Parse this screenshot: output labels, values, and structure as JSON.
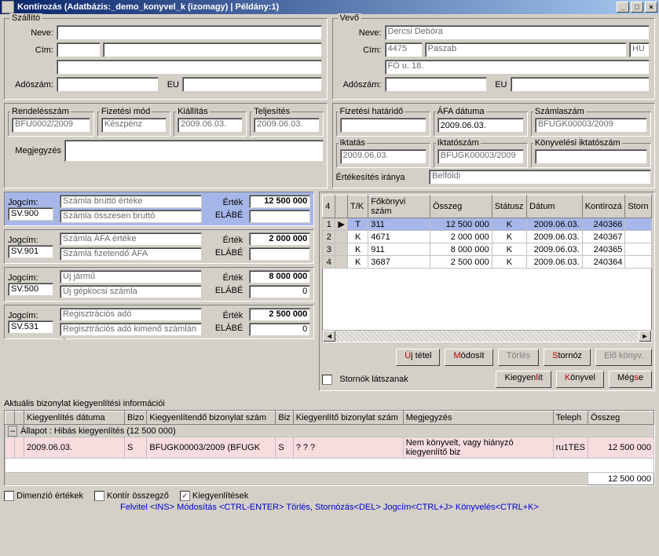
{
  "window": {
    "title": "Kontírozás  (Adatbázis:_demo_konyvel_k (izomagy) | Példány:1)"
  },
  "supplier": {
    "legend": "Szállító",
    "name_label": "Neve:",
    "name": "",
    "addr_label": "Cím:",
    "addr1": "",
    "addr2": "",
    "addr3": "",
    "tax_label": "Adószám:",
    "tax": "",
    "eu_label": "EU",
    "eu": ""
  },
  "buyer": {
    "legend": "Vevő",
    "name_label": "Neve:",
    "name": "Dercsi Debóra",
    "addr_label": "Cím:",
    "zip": "4475",
    "city": "Paszab",
    "ctry": "HU",
    "street": "FŐ u. 18.",
    "tax_label": "Adószám:",
    "tax": "",
    "eu_label": "EU",
    "eu": ""
  },
  "orderblock": {
    "order_no_lbl": "Rendelésszám",
    "order_no": "BFU0002/2009",
    "pay_lbl": "Fizetési mód",
    "pay": "Készpénz",
    "issue_lbl": "Kiállítás",
    "issue": "2009.06.03.",
    "fulfil_lbl": "Teljesítés",
    "fulfil": "2009.06.03.",
    "note_lbl": "Megjegyzés",
    "note": ""
  },
  "rightblock": {
    "due_lbl": "Fizetési határidő",
    "due": "",
    "vat_lbl": "ÁFA dátuma",
    "vat": "2009.06.03.",
    "inv_lbl": "Számlaszám",
    "inv": "BFUGK00003/2009",
    "reg_lbl": "Iktatás",
    "reg": "2009.06.03.",
    "regno_lbl": "Iktatószám",
    "regno": "BFUGK00003/2009",
    "bookreg_lbl": "Könyvelési iktatószám",
    "bookreg": "",
    "saledir_lbl": "Értékesítés iránya",
    "saledir": "Belföldi"
  },
  "jog": {
    "title_lbl": "Jogcím:",
    "val_lbl": "Érték",
    "elabe": "ELÁBÉ",
    "items": [
      {
        "code": "SV.900",
        "desc1": "Számla bruttó értéke",
        "desc2": "Számla összesen bruttó",
        "val": "12 500 000",
        "elabe": ""
      },
      {
        "code": "SV.901",
        "desc1": "Számla ÁFA értéke",
        "desc2": "Számla fizetendő ÁFA",
        "val": "2 000 000",
        "elabe": ""
      },
      {
        "code": "SV.500",
        "desc1": "Új jármű",
        "desc2": "Új gépkocsi számla",
        "val": "8 000 000",
        "elabe": "0"
      },
      {
        "code": "SV.531",
        "desc1": "Regisztrációs adó",
        "desc2": "Regisztrációs adó kimenő számlán -",
        "val": "2 500 000",
        "elabe": "0"
      }
    ]
  },
  "grid": {
    "headers": [
      "4",
      "",
      "T/K",
      "Főkönyvi szám",
      "Összeg",
      "Státusz",
      "Dátum",
      "Kontírozá",
      "Storn"
    ],
    "rows": [
      {
        "n": "1",
        "sel": true,
        "tk": "T",
        "acc": "311",
        "amt": "12 500 000",
        "st": "K",
        "dt": "2009.06.03.",
        "kid": "240366"
      },
      {
        "n": "2",
        "tk": "K",
        "acc": "4671",
        "amt": "2 000 000",
        "st": "K",
        "dt": "2009.06.03.",
        "kid": "240367"
      },
      {
        "n": "3",
        "tk": "K",
        "acc": "911",
        "amt": "8 000 000",
        "st": "K",
        "dt": "2009.06.03.",
        "kid": "240365"
      },
      {
        "n": "4",
        "tk": "K",
        "acc": "3687",
        "amt": "2 500 000",
        "st": "K",
        "dt": "2009.06.03.",
        "kid": "240364"
      }
    ]
  },
  "buttons": {
    "new": {
      "pre": "",
      "accel": "Ú",
      "post": "j tétel"
    },
    "modify": {
      "pre": "",
      "accel": "M",
      "post": "ódosít"
    },
    "delete": "Törlés",
    "storno": {
      "pre": "",
      "accel": "S",
      "post": "tornóz"
    },
    "prebook": {
      "pre": "",
      "accel": "E",
      "post": "lő könyv."
    },
    "show_storno": "Stornók látszanak",
    "settle": {
      "pre": "Kiegyen",
      "accel": "l",
      "post": "ít"
    },
    "book": {
      "pre": "",
      "accel": "K",
      "post": "önyvel"
    },
    "cancel": {
      "pre": "Még",
      "accel": "s",
      "post": "e"
    }
  },
  "settle": {
    "title": "Aktuális bizonylat kiegyenlítési információi",
    "headers": [
      "",
      "",
      "Kiegyenlítés dátuma",
      "Bizo",
      "Kiegyenlítendő bizonylat szám",
      "Biz",
      "Kiegyenlítő bizonylat szám",
      "Megjegyzés",
      "Teleph",
      "Összeg"
    ],
    "group": "Állapot : Hibás kiegyenlítés (12 500 000)",
    "row": {
      "date": "2009.06.03.",
      "bt": "S",
      "doc": "BFUGK00003/2009 (BFUGK",
      "bt2": "S",
      "kdoc": "? ? ?",
      "note": "Nem könyvelt, vagy hiányzó kiegyenlítő biz",
      "tel": "ru1TES",
      "amt": "12 500 000"
    },
    "total": "12 500 000"
  },
  "footer": {
    "dim": "Dimenzió értékek",
    "kont": "Kontír összegző",
    "kieg": "Kiegyenlítések",
    "hint": "Felvitel <INS> Módosítás <CTRL-ENTER> Törlés, Stornózás<DEL> Jogcím<CTRL+J> Könyvelés<CTRL+K>"
  }
}
